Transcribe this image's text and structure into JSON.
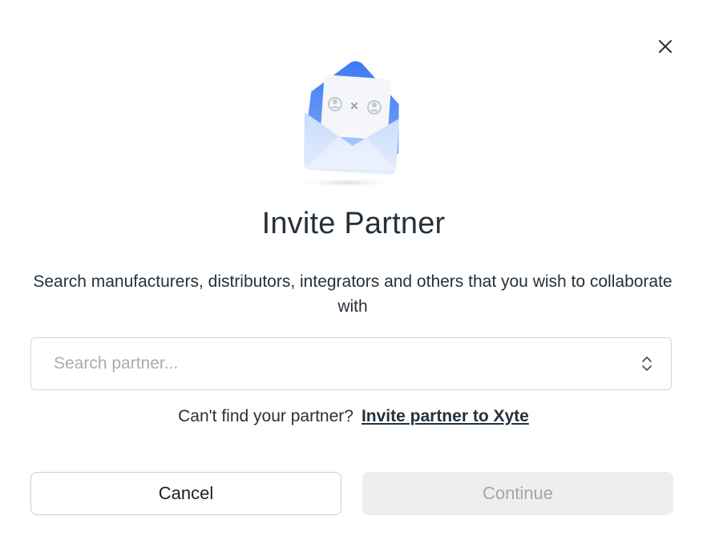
{
  "dialog": {
    "title": "Invite Partner",
    "subtitle": "Search manufacturers, distributors, integrators and others that you wish to collaborate with",
    "close_icon": "close-icon",
    "illustration_icon": "envelope-partners-illustration"
  },
  "search": {
    "placeholder": "Search partner...",
    "value": "",
    "icon": "chevron-up-down-icon"
  },
  "hint": {
    "text": "Can't find your partner?",
    "link_label": "Invite partner to Xyte"
  },
  "actions": {
    "cancel_label": "Cancel",
    "continue_label": "Continue",
    "continue_disabled": true
  },
  "colors": {
    "envelope_blue": "#4f86f7",
    "envelope_light": "#cfe0fb",
    "border": "#d2d6da",
    "text": "#25313b",
    "disabled_bg": "#eeeeee",
    "disabled_text": "#a3a7ab"
  }
}
